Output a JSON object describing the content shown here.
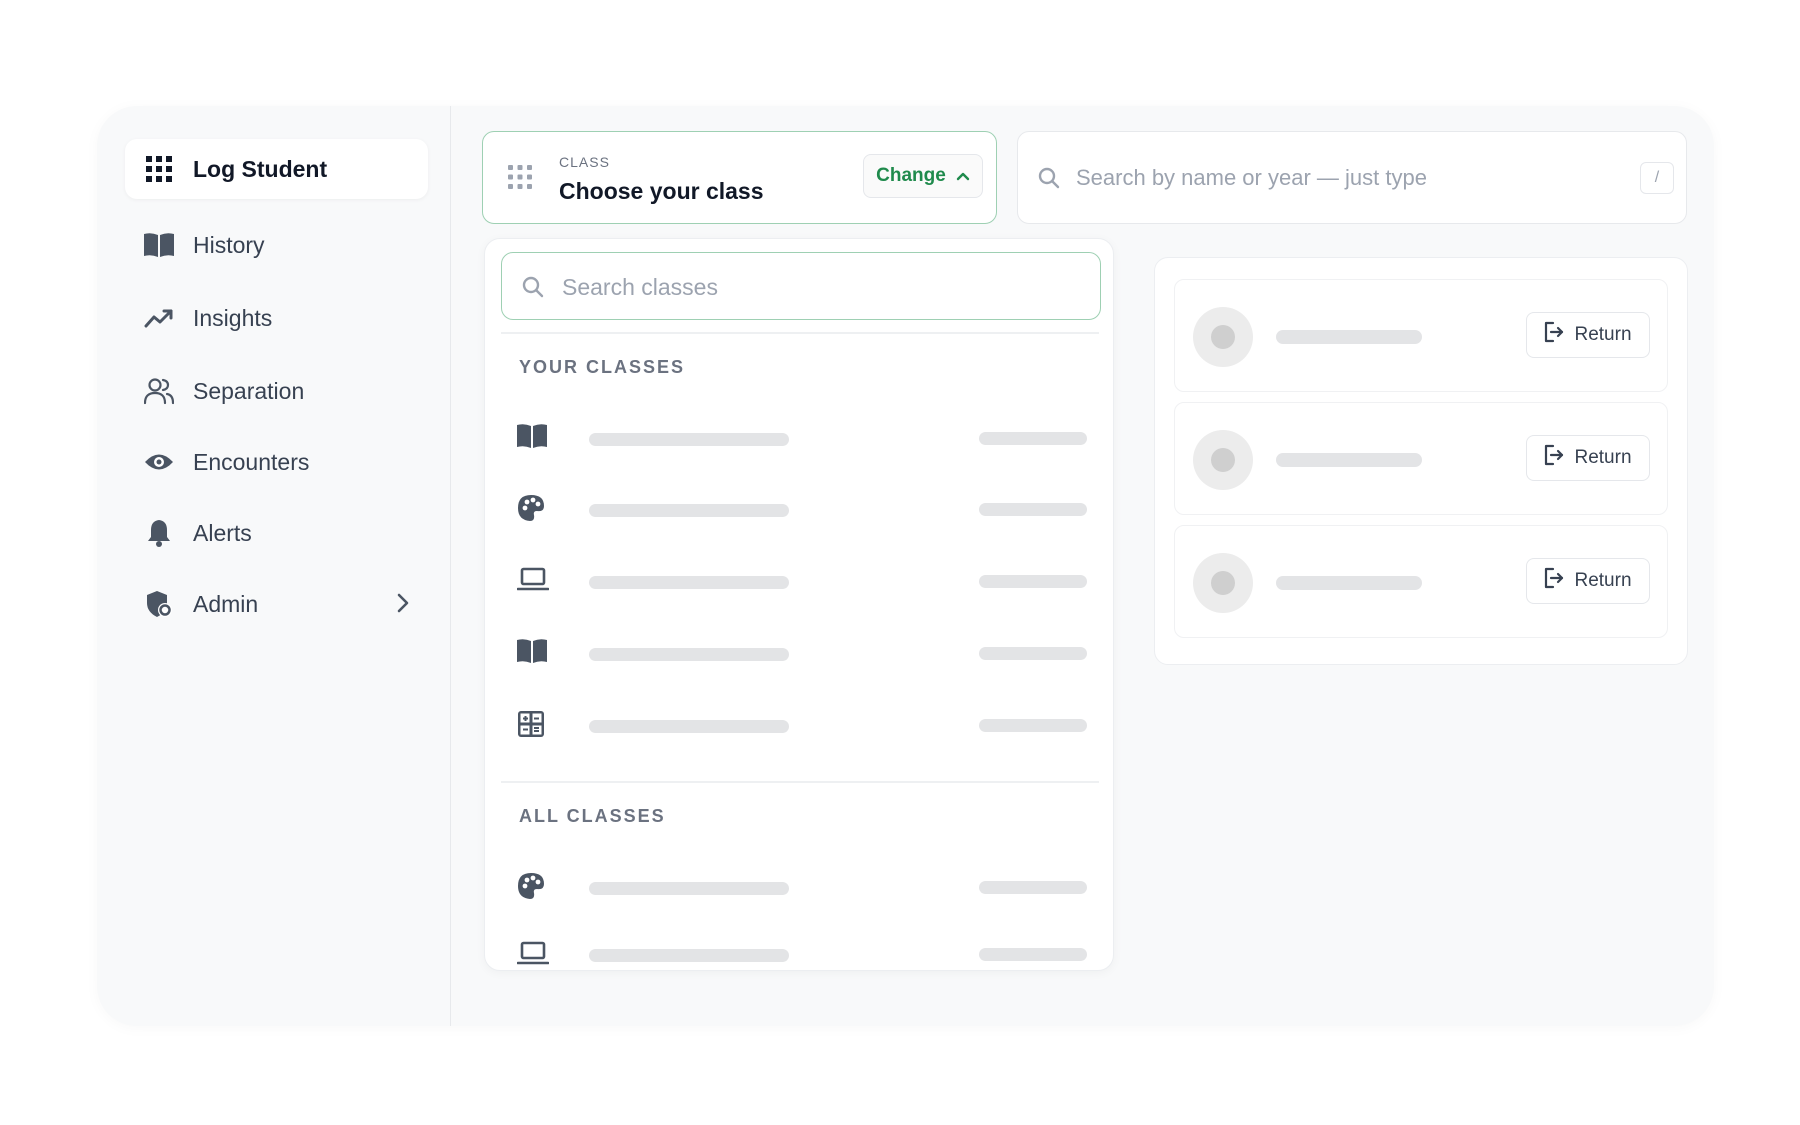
{
  "sidebar": {
    "items": [
      {
        "label": "Log Student",
        "icon": "grid-icon",
        "active": true
      },
      {
        "label": "History",
        "icon": "book-open-icon"
      },
      {
        "label": "Insights",
        "icon": "trending-up-icon"
      },
      {
        "label": "Separation",
        "icon": "users-icon"
      },
      {
        "label": "Encounters",
        "icon": "eye-icon"
      },
      {
        "label": "Alerts",
        "icon": "bell-icon"
      },
      {
        "label": "Admin",
        "icon": "shield-gear-icon",
        "has_submenu": true
      }
    ]
  },
  "class_picker": {
    "caption": "CLASS",
    "title": "Choose your class",
    "change_label": "Change",
    "accent": "#1f8a4c"
  },
  "student_search": {
    "placeholder": "Search by name or year — just type",
    "shortcut": "/"
  },
  "class_dropdown": {
    "search_placeholder": "Search classes",
    "your_classes_title": "YOUR CLASSES",
    "all_classes_title": "ALL CLASSES",
    "your_classes": [
      {
        "icon": "book-open-icon",
        "loading": true
      },
      {
        "icon": "palette-icon",
        "loading": true
      },
      {
        "icon": "laptop-icon",
        "loading": true
      },
      {
        "icon": "book-open-icon",
        "loading": true
      },
      {
        "icon": "calculator-icon",
        "loading": true
      }
    ],
    "all_classes": [
      {
        "icon": "palette-icon",
        "loading": true
      },
      {
        "icon": "laptop-icon",
        "loading": true
      }
    ]
  },
  "students": {
    "return_label": "Return",
    "rows": [
      {
        "loading": true
      },
      {
        "loading": true
      },
      {
        "loading": true
      }
    ]
  }
}
